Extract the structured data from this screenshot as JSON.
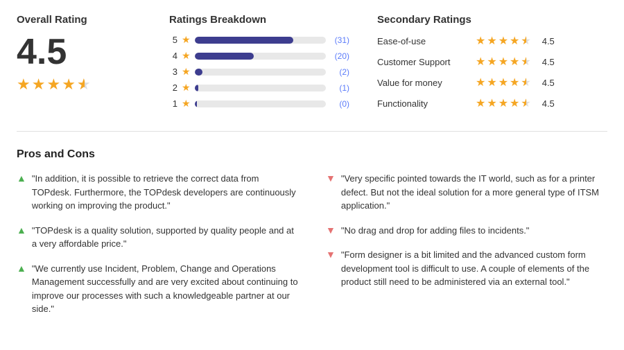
{
  "header": {
    "overall_rating_title": "Overall Rating",
    "score": "4.5",
    "breakdown_title": "Ratings Breakdown",
    "secondary_title": "Secondary Ratings"
  },
  "breakdown": [
    {
      "stars": 5,
      "width_pct": 75,
      "count": "(31)"
    },
    {
      "stars": 4,
      "width_pct": 45,
      "count": "(20)"
    },
    {
      "stars": 3,
      "width_pct": 6,
      "count": "(2)"
    },
    {
      "stars": 2,
      "width_pct": 3,
      "count": "(1)"
    },
    {
      "stars": 1,
      "width_pct": 2,
      "count": "(0)"
    }
  ],
  "secondary": [
    {
      "label": "Ease-of-use",
      "score": "4.5"
    },
    {
      "label": "Customer Support",
      "score": "4.5"
    },
    {
      "label": "Value for money",
      "score": "4.5"
    },
    {
      "label": "Functionality",
      "score": "4.5"
    }
  ],
  "pros_cons": {
    "title": "Pros and Cons",
    "pros": [
      "\"In addition, it is possible to retrieve the correct data from TOPdesk. Furthermore, the TOPdesk developers are continuously working on improving the product.\"",
      "\"TOPdesk is a quality solution, supported by quality people and at a very affordable price.\"",
      "\"We currently use Incident, Problem, Change and Operations Management successfully and are very excited about continuing to improve our processes with such a knowledgeable partner at our side.\""
    ],
    "cons": [
      "\"Very specific pointed towards the IT world, such as for a printer defect. But not the ideal solution for a more general type of ITSM application.\"",
      "\"No drag and drop for adding files to incidents.\"",
      "\"Form designer is a bit limited and the advanced custom form development tool is difficult to use. A couple of elements of the product still need to be administered via an external tool.\""
    ]
  }
}
